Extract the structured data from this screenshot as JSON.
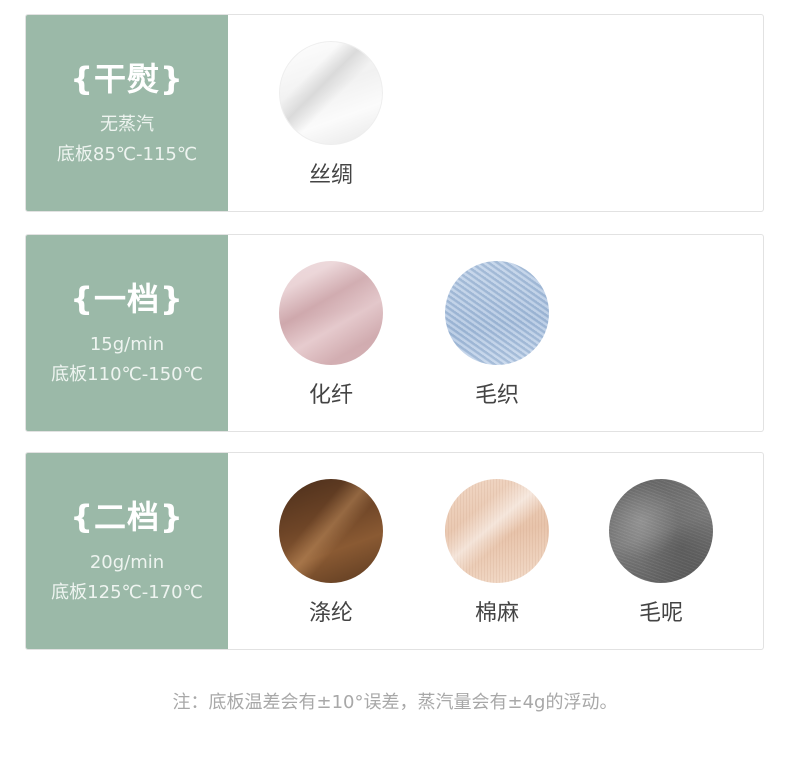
{
  "settings": [
    {
      "title": "{干熨}",
      "line1": "无蒸汽",
      "line2": "底板85℃-115℃",
      "fabrics": [
        {
          "label": "丝绸",
          "swatch": "silk-swatch"
        }
      ]
    },
    {
      "title": "{一档}",
      "line1": "15g/min",
      "line2": "底板110℃-150℃",
      "fabrics": [
        {
          "label": "化纤",
          "swatch": "synthetic-fiber-swatch"
        },
        {
          "label": "毛织",
          "swatch": "wool-knit-swatch"
        }
      ]
    },
    {
      "title": "{二档}",
      "line1": "20g/min",
      "line2": "底板125℃-170℃",
      "fabrics": [
        {
          "label": "涤纶",
          "swatch": "polyester-swatch"
        },
        {
          "label": "棉麻",
          "swatch": "linen-swatch"
        },
        {
          "label": "毛呢",
          "swatch": "wool-felt-swatch"
        }
      ]
    }
  ],
  "note": "注：底板温差会有±10°误差，蒸汽量会有±4g的浮动。",
  "colors": {
    "side_panel": "#9bb9a8",
    "border": "#e2e2e2",
    "label_text": "#444444",
    "note_text": "#a8a8a8"
  }
}
